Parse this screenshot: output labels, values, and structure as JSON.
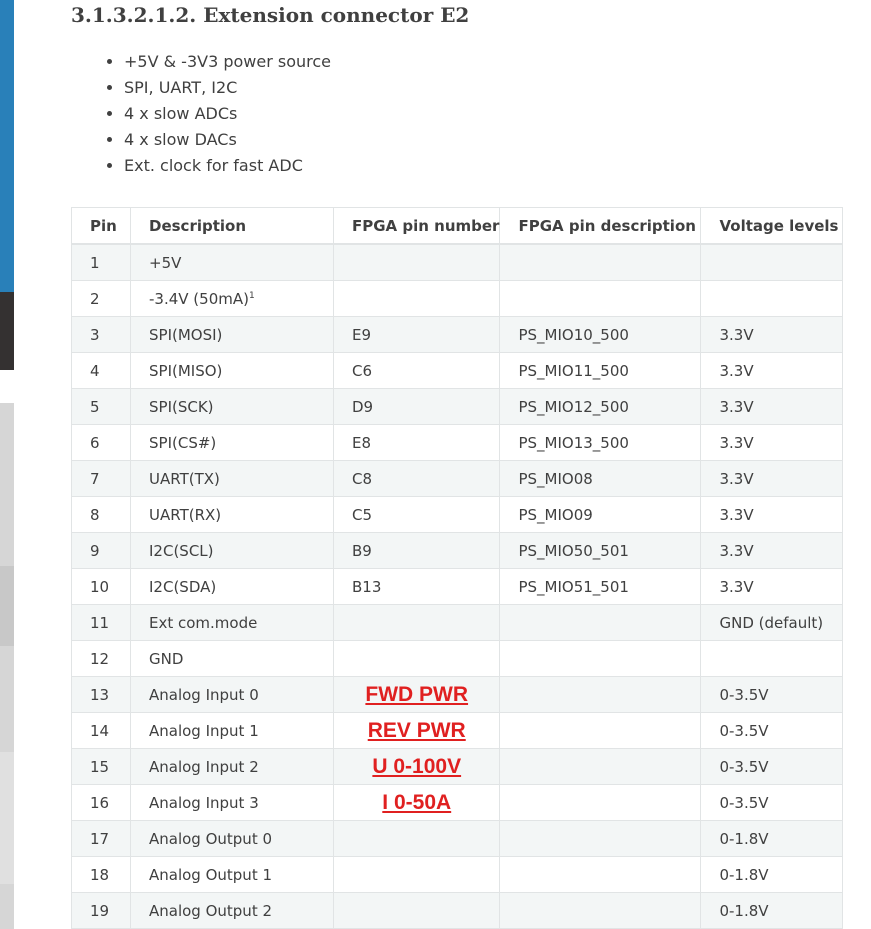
{
  "section": {
    "title": "3.1.3.2.1.2. Extension connector E2"
  },
  "features": [
    "+5V & -3V3 power source",
    "SPI, UART, I2C",
    "4 x slow ADCs",
    "4 x slow DACs",
    "Ext. clock for fast ADC"
  ],
  "table": {
    "headers": [
      "Pin",
      "Description",
      "FPGA pin number",
      "FPGA pin description",
      "Voltage levels"
    ],
    "rows": [
      {
        "pin": "1",
        "desc": "+5V",
        "fpga": "",
        "fdesc": "",
        "volt": ""
      },
      {
        "pin": "2",
        "desc": "-3.4V (50mA)",
        "sup": "1",
        "fpga": "",
        "fdesc": "",
        "volt": ""
      },
      {
        "pin": "3",
        "desc": "SPI(MOSI)",
        "fpga": "E9",
        "fdesc": "PS_MIO10_500",
        "volt": "3.3V"
      },
      {
        "pin": "4",
        "desc": "SPI(MISO)",
        "fpga": "C6",
        "fdesc": "PS_MIO11_500",
        "volt": "3.3V"
      },
      {
        "pin": "5",
        "desc": "SPI(SCK)",
        "fpga": "D9",
        "fdesc": "PS_MIO12_500",
        "volt": "3.3V"
      },
      {
        "pin": "6",
        "desc": "SPI(CS#)",
        "fpga": "E8",
        "fdesc": "PS_MIO13_500",
        "volt": "3.3V"
      },
      {
        "pin": "7",
        "desc": "UART(TX)",
        "fpga": "C8",
        "fdesc": "PS_MIO08",
        "volt": "3.3V"
      },
      {
        "pin": "8",
        "desc": "UART(RX)",
        "fpga": "C5",
        "fdesc": "PS_MIO09",
        "volt": "3.3V"
      },
      {
        "pin": "9",
        "desc": "I2C(SCL)",
        "fpga": "B9",
        "fdesc": "PS_MIO50_501",
        "volt": "3.3V"
      },
      {
        "pin": "10",
        "desc": "I2C(SDA)",
        "fpga": "B13",
        "fdesc": "PS_MIO51_501",
        "volt": "3.3V"
      },
      {
        "pin": "11",
        "desc": "Ext com.mode",
        "fpga": "",
        "fdesc": "",
        "volt": "GND (default)"
      },
      {
        "pin": "12",
        "desc": "GND",
        "fpga": "",
        "fdesc": "",
        "volt": ""
      },
      {
        "pin": "13",
        "desc": "Analog Input 0",
        "fpga": "",
        "annot": "FWD PWR",
        "fdesc": "",
        "volt": "0-3.5V"
      },
      {
        "pin": "14",
        "desc": "Analog Input 1",
        "fpga": "",
        "annot": "REV PWR",
        "fdesc": "",
        "volt": "0-3.5V"
      },
      {
        "pin": "15",
        "desc": "Analog Input 2",
        "fpga": "",
        "annot": "U 0-100V",
        "fdesc": "",
        "volt": "0-3.5V"
      },
      {
        "pin": "16",
        "desc": "Analog Input 3",
        "fpga": "",
        "annot": "I 0-50A",
        "fdesc": "",
        "volt": "0-3.5V"
      },
      {
        "pin": "17",
        "desc": "Analog Output 0",
        "fpga": "",
        "fdesc": "",
        "volt": "0-1.8V"
      },
      {
        "pin": "18",
        "desc": "Analog Output 1",
        "fpga": "",
        "fdesc": "",
        "volt": "0-1.8V"
      },
      {
        "pin": "19",
        "desc": "Analog Output 2",
        "fpga": "",
        "fdesc": "",
        "volt": "0-1.8V"
      }
    ]
  },
  "colors": {
    "sidebar_blue": "#2980b9",
    "sidebar_dark": "#343131",
    "annotation_red": "#e02020",
    "row_stripe": "#f3f6f6",
    "border": "#e1e4e5"
  }
}
